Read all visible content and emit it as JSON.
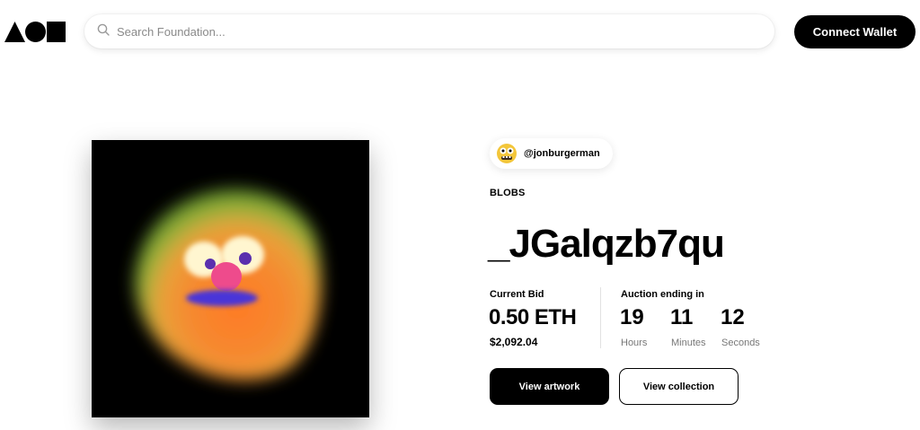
{
  "header": {
    "logo_name": "foundation-logo",
    "search": {
      "placeholder": "Search Foundation...",
      "value": ""
    },
    "connect_label": "Connect Wallet"
  },
  "artwork": {
    "image_name": "blob-artwork"
  },
  "creator": {
    "handle": "@jonburgerman",
    "avatar_icon": "creator-avatar"
  },
  "nft": {
    "collection": "BLOBS",
    "title": "_JGalqzb7qu"
  },
  "bid": {
    "label": "Current Bid",
    "eth": "0.50 ETH",
    "usd": "$2,092.04"
  },
  "auction": {
    "label": "Auction ending in",
    "hours": "19",
    "hours_label": "Hours",
    "minutes": "11",
    "minutes_label": "Minutes",
    "seconds": "12",
    "seconds_label": "Seconds"
  },
  "actions": {
    "view_artwork": "View artwork",
    "view_collection": "View collection"
  },
  "colors": {
    "primary": "#000000",
    "background": "#ffffff",
    "muted": "#777777"
  }
}
